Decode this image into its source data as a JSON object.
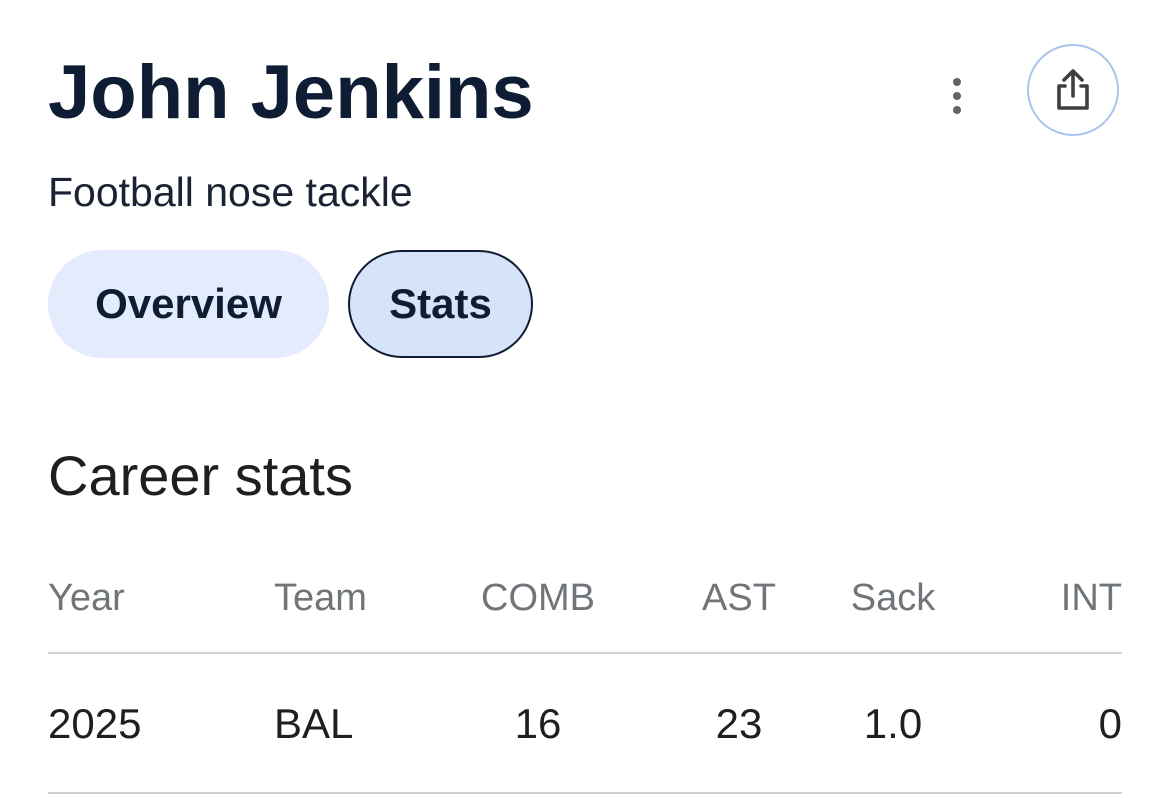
{
  "header": {
    "name": "John Jenkins",
    "subtitle": "Football nose tackle",
    "more_icon": "vertical-ellipsis-icon",
    "share_icon": "share-icon"
  },
  "tabs": [
    {
      "label": "Overview",
      "selected": false
    },
    {
      "label": "Stats",
      "selected": true
    }
  ],
  "career_stats": {
    "title": "Career stats",
    "columns": [
      "Year",
      "Team",
      "COMB",
      "AST",
      "Sack",
      "INT"
    ],
    "rows": [
      {
        "year": "2025",
        "team": "BAL",
        "comb": "16",
        "ast": "23",
        "sack": "1.0",
        "int": "0"
      }
    ]
  },
  "colors": {
    "title_text": "#0e1d33",
    "tab_background": "#e3ebfc",
    "selected_tab_border": "#0e1d33",
    "link": "#1a56c4",
    "share_button_border": "#a8c4ee",
    "divider": "#d0d3d7"
  }
}
